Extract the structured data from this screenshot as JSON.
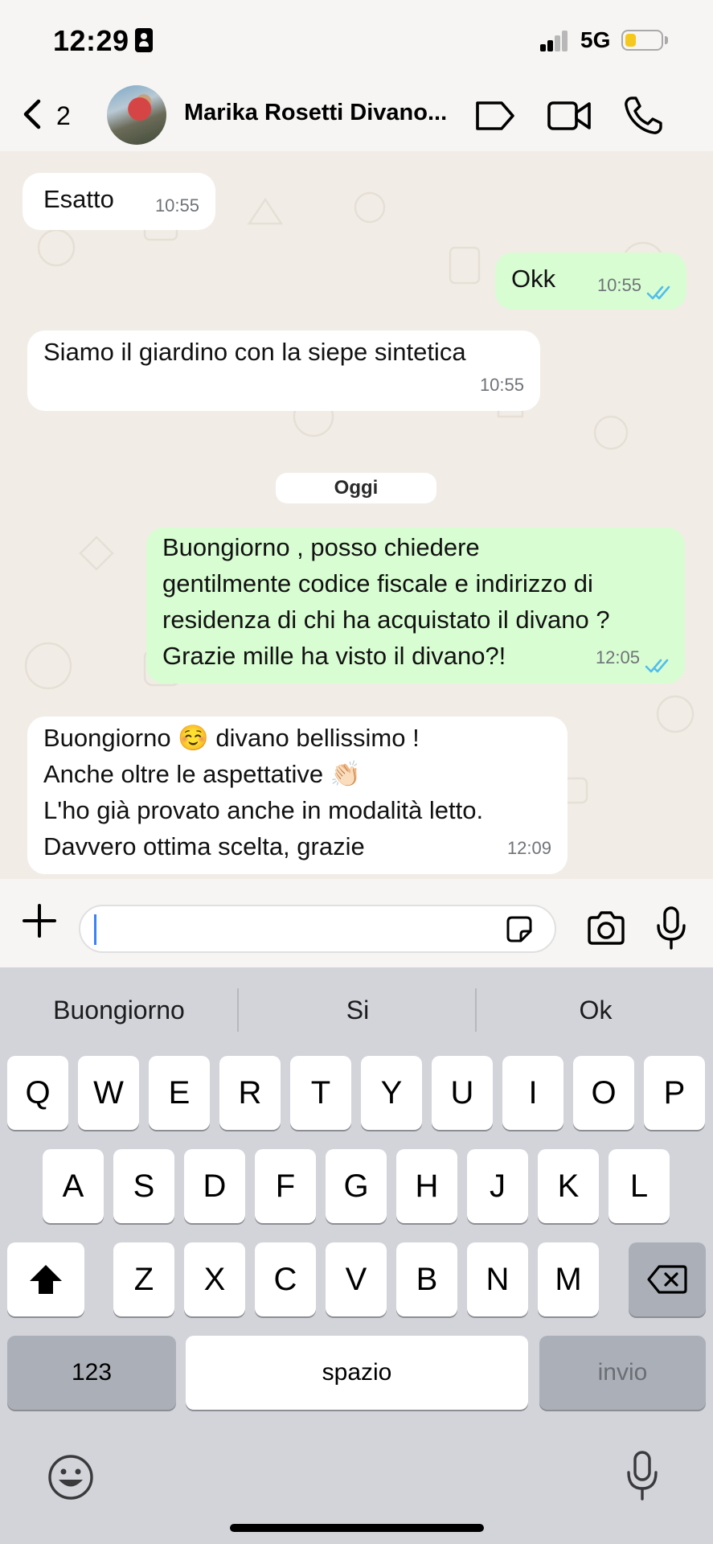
{
  "status_bar": {
    "time": "12:29",
    "network": "5G",
    "battery_level": 0.3,
    "battery_color": "#f4c81c"
  },
  "header": {
    "back_count": "2",
    "contact_name": "Marika Rosetti Divano...",
    "icons": [
      "chevron-left-icon",
      "tag-icon",
      "video-call-icon",
      "phone-icon"
    ]
  },
  "messages": [
    {
      "direction": "in",
      "text": "Esatto",
      "time": "10:55"
    },
    {
      "direction": "out",
      "text": "Okk",
      "time": "10:55",
      "read": true
    },
    {
      "direction": "in",
      "text": "Siamo il giardino con la siepe sintetica",
      "time": "10:55"
    },
    {
      "direction": "out",
      "lines": [
        "Buongiorno , posso chiedere",
        "gentilmente codice fiscale e indirizzo di",
        "residenza di chi ha acquistato il divano ?",
        "Grazie mille ha visto il divano?!"
      ],
      "time": "12:05",
      "read": true
    },
    {
      "direction": "in",
      "lines": [
        "Buongiorno ☺️ divano bellissimo !",
        "Anche oltre le aspettative 👏🏻",
        "L'ho già provato anche in modalità letto.",
        "Davvero ottima scelta, grazie"
      ],
      "time": "12:09"
    }
  ],
  "date_divider": "Oggi",
  "composer": {
    "placeholder": "",
    "icons": [
      "plus-icon",
      "sticker-icon",
      "camera-icon",
      "microphone-icon"
    ]
  },
  "keyboard": {
    "suggestions": [
      "Buongiorno",
      "Si",
      "Ok"
    ],
    "row1": [
      "Q",
      "W",
      "E",
      "R",
      "T",
      "Y",
      "U",
      "I",
      "O",
      "P"
    ],
    "row2": [
      "A",
      "S",
      "D",
      "F",
      "G",
      "H",
      "J",
      "K",
      "L"
    ],
    "row3": [
      "Z",
      "X",
      "C",
      "V",
      "B",
      "N",
      "M"
    ],
    "numbers_label": "123",
    "space_label": "spazio",
    "return_label": "invio",
    "bottom_icons": [
      "emoji-icon",
      "dictation-mic-icon"
    ]
  },
  "colors": {
    "outgoing_bubble": "#d8fdd2",
    "incoming_bubble": "#ffffff",
    "chat_background": "#f1ede6",
    "read_tick": "#53bdeb",
    "keyboard_background": "#d2d4da"
  }
}
